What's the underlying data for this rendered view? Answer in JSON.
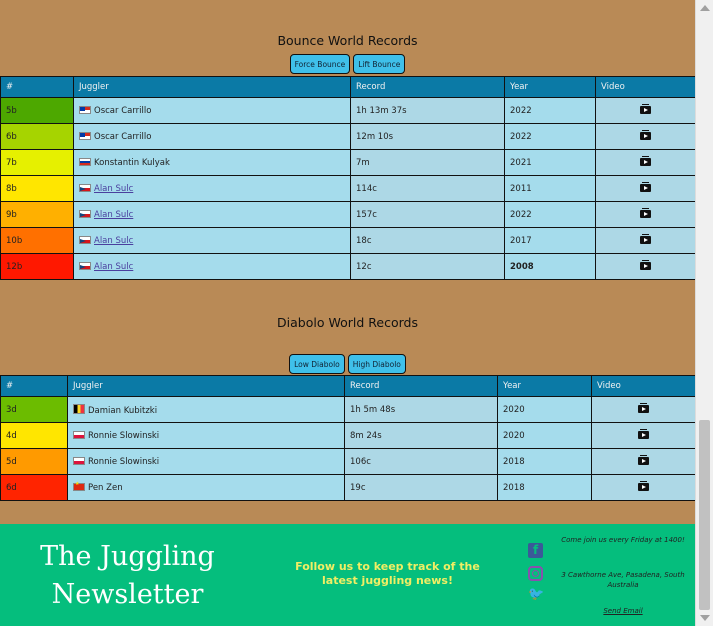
{
  "bounce": {
    "title": "Bounce World Records",
    "tabs": [
      "Force Bounce",
      "Lift Bounce"
    ],
    "headers": [
      "#",
      "Juggler",
      "Record",
      "Year",
      "Video"
    ],
    "rows": [
      {
        "diff": "5b",
        "flag": "cl",
        "juggler": "Oscar Carrillo",
        "linked": false,
        "record": "1h 13m 37s",
        "year": "2022",
        "bold_year": false
      },
      {
        "diff": "6b",
        "flag": "cl",
        "juggler": "Oscar Carrillo",
        "linked": false,
        "record": "12m 10s",
        "year": "2022",
        "bold_year": false
      },
      {
        "diff": "7b",
        "flag": "ru",
        "juggler": "Konstantin Kulyak",
        "linked": false,
        "record": "7m",
        "year": "2021",
        "bold_year": false
      },
      {
        "diff": "8b",
        "flag": "cz",
        "juggler": "Alan Sulc",
        "linked": true,
        "record": "114c",
        "year": "2011",
        "bold_year": false
      },
      {
        "diff": "9b",
        "flag": "cz",
        "juggler": "Alan Sulc",
        "linked": true,
        "record": "157c",
        "year": "2022",
        "bold_year": false
      },
      {
        "diff": "10b",
        "flag": "cz",
        "juggler": "Alan Sulc",
        "linked": true,
        "record": "18c",
        "year": "2017",
        "bold_year": false
      },
      {
        "diff": "12b",
        "flag": "cz",
        "juggler": "Alan Sulc",
        "linked": true,
        "record": "12c",
        "year": "2008",
        "bold_year": true
      }
    ],
    "diff_colors": [
      "#4da800",
      "#a6d400",
      "#e6f000",
      "#ffe600",
      "#ffb000",
      "#ff7000",
      "#ff1800"
    ]
  },
  "diabolo": {
    "title": "Diabolo World Records",
    "tabs": [
      "Low Diabolo",
      "High Diabolo"
    ],
    "headers": [
      "#",
      "Juggler",
      "Record",
      "Year",
      "Video"
    ],
    "rows": [
      {
        "diff": "3d",
        "flag": "be",
        "juggler": "Damian Kubitzki",
        "linked": false,
        "record": "1h 5m 48s",
        "year": "2020",
        "bold_year": false
      },
      {
        "diff": "4d",
        "flag": "pl",
        "juggler": "Ronnie Slowinski",
        "linked": false,
        "record": "8m 24s",
        "year": "2020",
        "bold_year": false
      },
      {
        "diff": "5d",
        "flag": "pl",
        "juggler": "Ronnie Slowinski",
        "linked": false,
        "record": "106c",
        "year": "2018",
        "bold_year": false
      },
      {
        "diff": "6d",
        "flag": "cn",
        "juggler": "Pen Zen",
        "linked": false,
        "record": "19c",
        "year": "2018",
        "bold_year": false
      }
    ],
    "diff_colors": [
      "#6cbc00",
      "#ffe600",
      "#ff9a00",
      "#ff2400"
    ]
  },
  "footer": {
    "title": "The Juggling Newsletter",
    "follow": "Follow us to keep track of the latest juggling news!",
    "meet": "Come join us every Friday at 1400!",
    "address": "3 Cawthorne Ave, Pasadena, South Australia",
    "email": "Send Email"
  },
  "colors": {
    "page_bg": "#b98a56",
    "header_bg": "#0b7aa6",
    "cell_bg": "#a5dcec",
    "button_bg": "#3fc0ea",
    "footer_bg": "#05be7d",
    "follow_text": "#f1ee64"
  },
  "icons": {
    "video": "video-icon",
    "social": [
      "facebook-icon",
      "instagram-icon",
      "twitter-icon"
    ]
  }
}
